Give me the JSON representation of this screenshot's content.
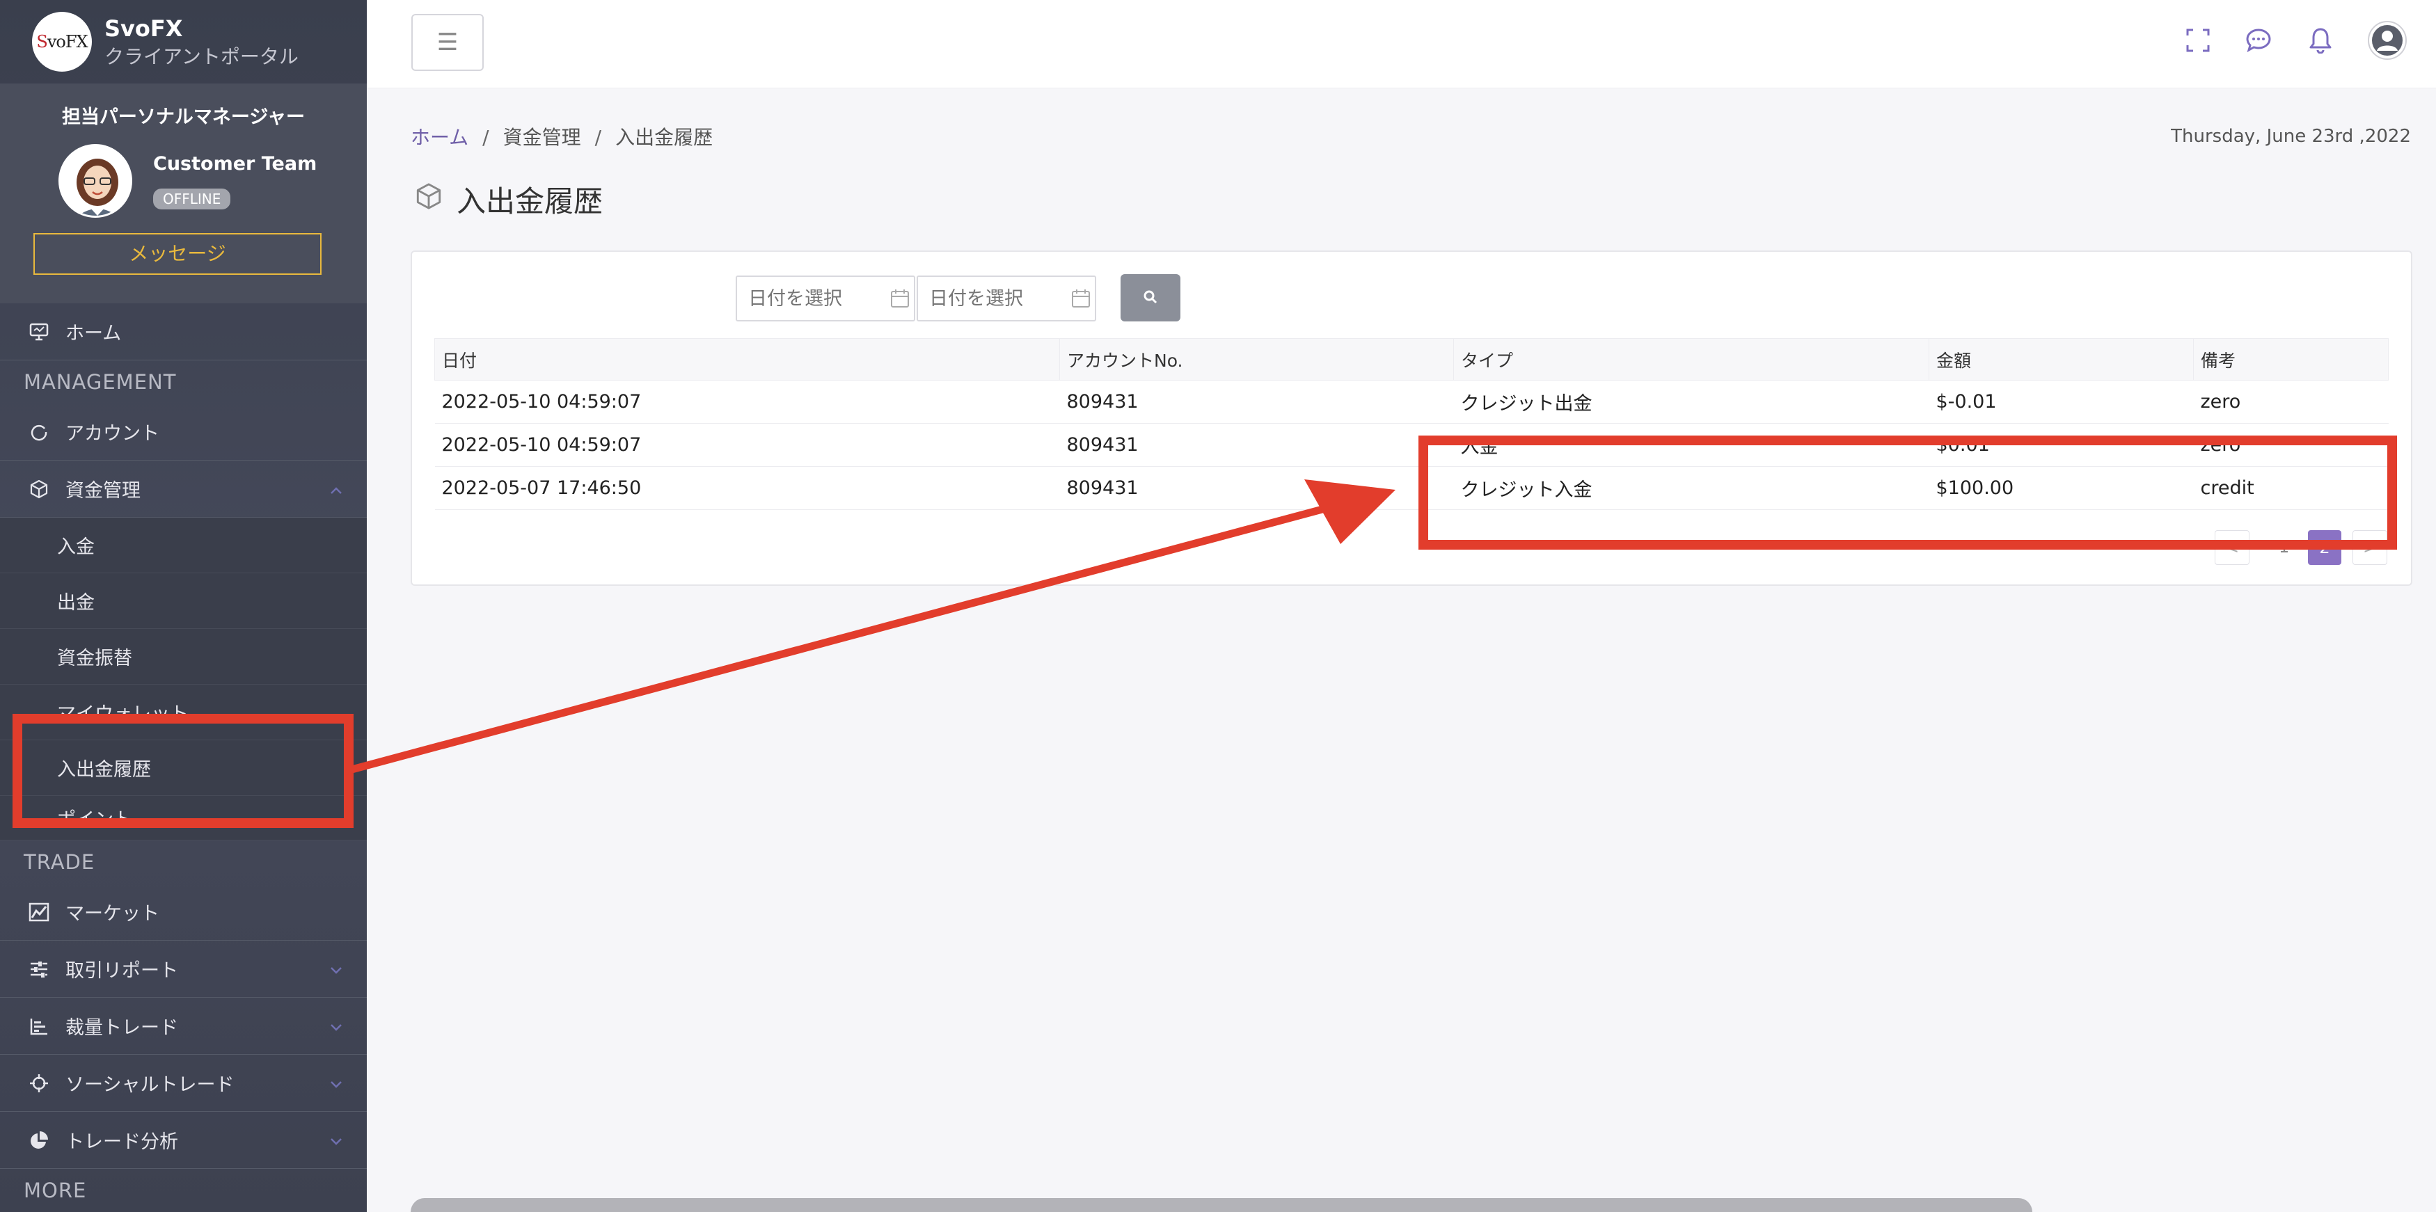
{
  "brand": {
    "logo_text": "SvoFX",
    "name": "SvoFX",
    "subtitle": "クライアントポータル"
  },
  "manager": {
    "title": "担当パーソナルマネージャー",
    "name": "Customer Team",
    "status": "OFFLINE",
    "message_button": "メッセージ"
  },
  "nav": {
    "home": "ホーム",
    "section_management": "MANAGEMENT",
    "account": "アカウント",
    "funds": "資金管理",
    "funds_sub": [
      "入金",
      "出金",
      "資金振替",
      "マイウォレット",
      "入出金履歴",
      "ポイント"
    ],
    "section_trade": "TRADE",
    "market": "マーケット",
    "trade_report": "取引リポート",
    "discretionary_trade": "裁量トレード",
    "social_trade": "ソーシャルトレード",
    "trade_analysis": "トレード分析",
    "section_more": "MORE"
  },
  "topbar": {
    "menu_icon": "☰",
    "icons": [
      "fullscreen-icon",
      "chat-icon",
      "bell-icon",
      "user-avatar-icon"
    ]
  },
  "breadcrumb": {
    "home": "ホーム",
    "sep": "/",
    "level2": "資金管理",
    "level3": "入出金履歴"
  },
  "date": "Thursday, June 23rd ,2022",
  "page_title": "入出金履歴",
  "filter": {
    "start_placeholder": "日付を選択",
    "end_placeholder": "日付を選択"
  },
  "table": {
    "headers": [
      "日付",
      "アカウントNo.",
      "タイプ",
      "金額",
      "備考"
    ],
    "rows": [
      [
        "2022-05-10 04:59:07",
        "809431",
        "クレジット出金",
        "$-0.01",
        "zero"
      ],
      [
        "2022-05-10 04:59:07",
        "809431",
        "入金",
        "$0.01",
        "zero"
      ],
      [
        "2022-05-07 17:46:50",
        "809431",
        "クレジット入金",
        "$100.00",
        "credit"
      ]
    ]
  },
  "pagination": {
    "prev": "<",
    "page1": "1",
    "page2": "2",
    "next": ">"
  },
  "colors": {
    "annotation": "#e23d2c",
    "accent": "#6f5fa8",
    "button_gold": "#e9b93d"
  }
}
